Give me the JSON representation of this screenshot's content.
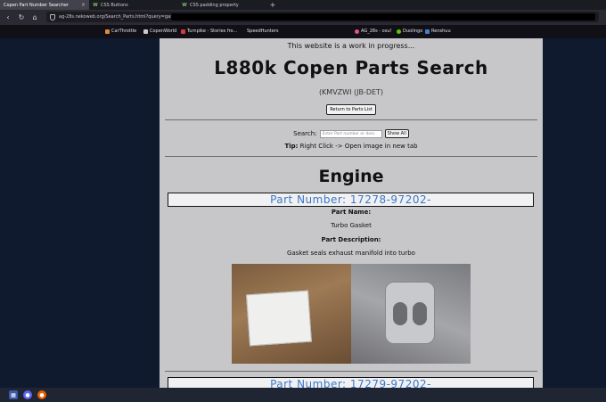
{
  "browser": {
    "tabs": [
      {
        "label": "Copen Part Number Searcher",
        "active": true
      },
      {
        "label": "CSS Buttons",
        "active": false
      },
      {
        "label": "CSS padding property",
        "active": false
      }
    ],
    "url": "ag-28s.nekoweb.org/Search_Parts.html?query=gasket",
    "bookmarks": [
      "CarThrottle",
      "CopenWorld",
      "Turnpike - Stories fro...",
      "SpeedHunters",
      "AG_28s - osu!",
      "Duolingo",
      "Renshuu"
    ]
  },
  "page": {
    "notice": "This website is a work in progress...",
    "title": "L880k Copen Parts Search",
    "engine": "(KMVZWI (JB-DET)",
    "return_button": "Return to Parts List",
    "search_label": "Search:",
    "search_placeholder": "Enter Part number or desc",
    "show_all_button": "Show All",
    "tip_label": "Tip:",
    "tip_text": " Right Click -> Open image in new tab",
    "section": "Engine",
    "part": {
      "number": "Part Number: 17278-97202-",
      "name_label": "Part Name:",
      "name": "Turbo Gasket",
      "desc_label": "Part Description:",
      "desc": "Gasket seals exhaust manifold into turbo"
    },
    "next_part_number": "Part Number: 17279-97202-"
  }
}
